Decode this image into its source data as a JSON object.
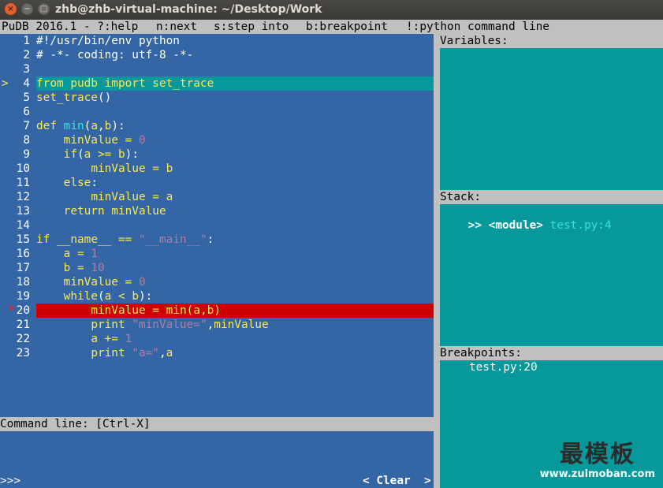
{
  "window": {
    "title": "zhb@zhb-virtual-machine: ~/Desktop/Work",
    "close_glyph": "×",
    "min_glyph": "−",
    "max_glyph": "□"
  },
  "menubar": {
    "version": "PuDB 2016.1 - ?:help",
    "next": "n:next",
    "step": "s:step into",
    "breakpoint": "b:breakpoint",
    "python": "!:python command line"
  },
  "source": {
    "current_marker": ">",
    "breakpoint_marker": "*",
    "lines": [
      {
        "n": "1",
        "parts": [
          [
            "cmt",
            "#!/usr/bin/env python"
          ]
        ]
      },
      {
        "n": "2",
        "parts": [
          [
            "cmt",
            "# -*- coding: utf-8 -*-"
          ]
        ]
      },
      {
        "n": "3",
        "parts": []
      },
      {
        "n": "4",
        "parts": [
          [
            "kw",
            "from"
          ],
          [
            "kw",
            " pudb "
          ],
          [
            "kw",
            "import"
          ],
          [
            "kw",
            " set_trace"
          ]
        ],
        "current": true
      },
      {
        "n": "5",
        "parts": [
          [
            "kw",
            "set_trace"
          ],
          [
            "wh",
            "()"
          ]
        ]
      },
      {
        "n": "6",
        "parts": []
      },
      {
        "n": "7",
        "parts": [
          [
            "kw",
            "def "
          ],
          [
            "fn",
            "min"
          ],
          [
            "wh",
            "("
          ],
          [
            "var",
            "a"
          ],
          [
            "wh",
            ","
          ],
          [
            "var",
            "b"
          ],
          [
            "wh",
            "):"
          ]
        ]
      },
      {
        "n": "8",
        "parts": [
          [
            "wh",
            "    "
          ],
          [
            "var",
            "minValue"
          ],
          [
            "wh",
            " "
          ],
          [
            "kw",
            "="
          ],
          [
            "wh",
            " "
          ],
          [
            "num",
            "0"
          ]
        ]
      },
      {
        "n": "9",
        "parts": [
          [
            "wh",
            "    "
          ],
          [
            "kw",
            "if"
          ],
          [
            "wh",
            "("
          ],
          [
            "var",
            "a"
          ],
          [
            "wh",
            " "
          ],
          [
            "kw",
            ">="
          ],
          [
            "wh",
            " "
          ],
          [
            "var",
            "b"
          ],
          [
            "wh",
            "):"
          ]
        ]
      },
      {
        "n": "10",
        "parts": [
          [
            "wh",
            "        "
          ],
          [
            "var",
            "minValue"
          ],
          [
            "wh",
            " "
          ],
          [
            "kw",
            "="
          ],
          [
            "wh",
            " "
          ],
          [
            "var",
            "b"
          ]
        ]
      },
      {
        "n": "11",
        "parts": [
          [
            "wh",
            "    "
          ],
          [
            "kw",
            "else"
          ],
          [
            "wh",
            ":"
          ]
        ]
      },
      {
        "n": "12",
        "parts": [
          [
            "wh",
            "        "
          ],
          [
            "var",
            "minValue"
          ],
          [
            "wh",
            " "
          ],
          [
            "kw",
            "="
          ],
          [
            "wh",
            " "
          ],
          [
            "var",
            "a"
          ]
        ]
      },
      {
        "n": "13",
        "parts": [
          [
            "wh",
            "    "
          ],
          [
            "kw",
            "return"
          ],
          [
            "wh",
            " "
          ],
          [
            "var",
            "minValue"
          ]
        ]
      },
      {
        "n": "14",
        "parts": []
      },
      {
        "n": "15",
        "parts": [
          [
            "kw",
            "if"
          ],
          [
            "wh",
            " "
          ],
          [
            "var",
            "__name__"
          ],
          [
            "wh",
            " "
          ],
          [
            "kw",
            "=="
          ],
          [
            "wh",
            " "
          ],
          [
            "str",
            "\"__main__\""
          ],
          [
            "wh",
            ":"
          ]
        ]
      },
      {
        "n": "16",
        "parts": [
          [
            "wh",
            "    "
          ],
          [
            "var",
            "a"
          ],
          [
            "wh",
            " "
          ],
          [
            "kw",
            "="
          ],
          [
            "wh",
            " "
          ],
          [
            "num",
            "1"
          ]
        ]
      },
      {
        "n": "17",
        "parts": [
          [
            "wh",
            "    "
          ],
          [
            "var",
            "b"
          ],
          [
            "wh",
            " "
          ],
          [
            "kw",
            "="
          ],
          [
            "wh",
            " "
          ],
          [
            "num",
            "10"
          ]
        ]
      },
      {
        "n": "18",
        "parts": [
          [
            "wh",
            "    "
          ],
          [
            "var",
            "minValue"
          ],
          [
            "wh",
            " "
          ],
          [
            "kw",
            "="
          ],
          [
            "wh",
            " "
          ],
          [
            "num",
            "0"
          ]
        ]
      },
      {
        "n": "19",
        "parts": [
          [
            "wh",
            "    "
          ],
          [
            "kw",
            "while"
          ],
          [
            "wh",
            "("
          ],
          [
            "var",
            "a"
          ],
          [
            "wh",
            " "
          ],
          [
            "kw",
            "<"
          ],
          [
            "wh",
            " "
          ],
          [
            "var",
            "b"
          ],
          [
            "wh",
            "):"
          ]
        ]
      },
      {
        "n": "20",
        "parts": [
          [
            "wh",
            "        "
          ],
          [
            "var",
            "minValue"
          ],
          [
            "wh",
            " "
          ],
          [
            "kw",
            "="
          ],
          [
            "wh",
            " "
          ],
          [
            "kw",
            "min"
          ],
          [
            "kw",
            "("
          ],
          [
            "kw",
            "a"
          ],
          [
            "kw",
            ","
          ],
          [
            "kw",
            "b"
          ],
          [
            "kw",
            ")"
          ]
        ],
        "breakpoint": true
      },
      {
        "n": "21",
        "parts": [
          [
            "wh",
            "        "
          ],
          [
            "kw",
            "print"
          ],
          [
            "wh",
            " "
          ],
          [
            "str",
            "\"minValue=\""
          ],
          [
            "wh",
            ","
          ],
          [
            "var",
            "minValue"
          ]
        ]
      },
      {
        "n": "22",
        "parts": [
          [
            "wh",
            "        "
          ],
          [
            "var",
            "a"
          ],
          [
            "wh",
            " "
          ],
          [
            "kw",
            "+="
          ],
          [
            "wh",
            " "
          ],
          [
            "num",
            "1"
          ]
        ]
      },
      {
        "n": "23",
        "parts": [
          [
            "wh",
            "        "
          ],
          [
            "kw",
            "print"
          ],
          [
            "wh",
            " "
          ],
          [
            "str",
            "\"a=\""
          ],
          [
            "wh",
            ","
          ],
          [
            "var",
            "a"
          ]
        ]
      }
    ]
  },
  "variables": {
    "header": "Variables:"
  },
  "stack": {
    "header": "Stack:",
    "frame_marker": ">>",
    "frame_name": "<module>",
    "frame_loc": "test.py:4"
  },
  "breakpoints": {
    "header": "Breakpoints:",
    "items": [
      "test.py:20"
    ]
  },
  "command": {
    "header": "Command line: [Ctrl-X]",
    "prompt": ">>>",
    "clear_label": "< Clear  >"
  },
  "watermark": {
    "cn": "最模板",
    "url": "www.zuimoban.com"
  }
}
